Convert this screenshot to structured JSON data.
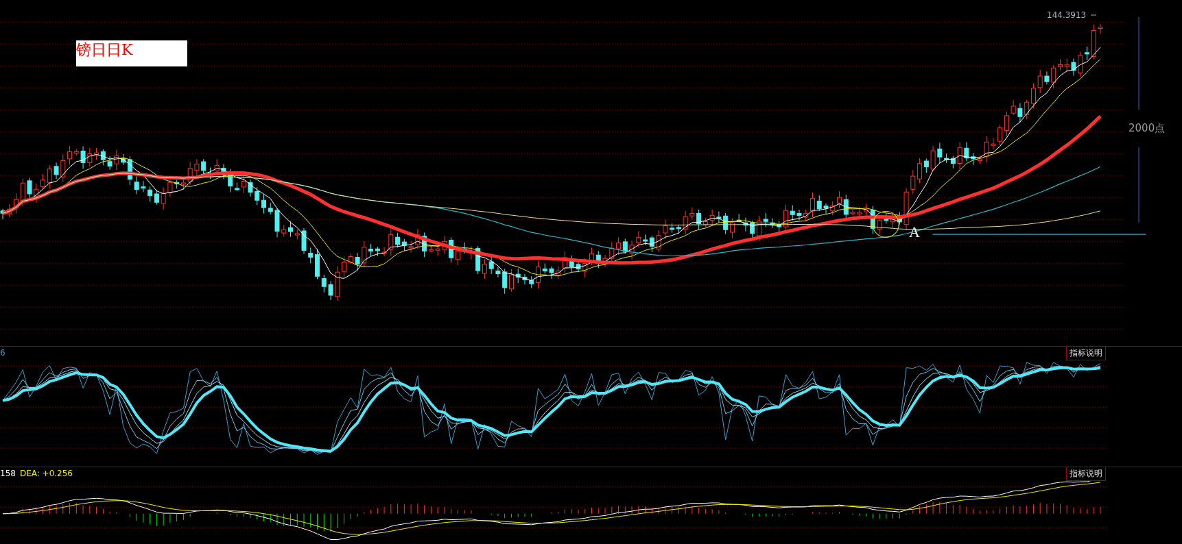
{
  "main_chart": {
    "title": "镑日日K",
    "price_label": "144.3913",
    "range_label": "2000点",
    "point_label": "A"
  },
  "indicator_panels": [
    {
      "kind": "kdj",
      "label_parts": [
        {
          "kind": "value",
          "text": "6"
        }
      ],
      "button": "指标说明"
    },
    {
      "kind": "macd",
      "label_parts": [
        {
          "kind": "diff",
          "text": "158"
        },
        {
          "kind": "dea",
          "text": "DEA: +0.256"
        }
      ],
      "button": "指标说明"
    }
  ]
}
